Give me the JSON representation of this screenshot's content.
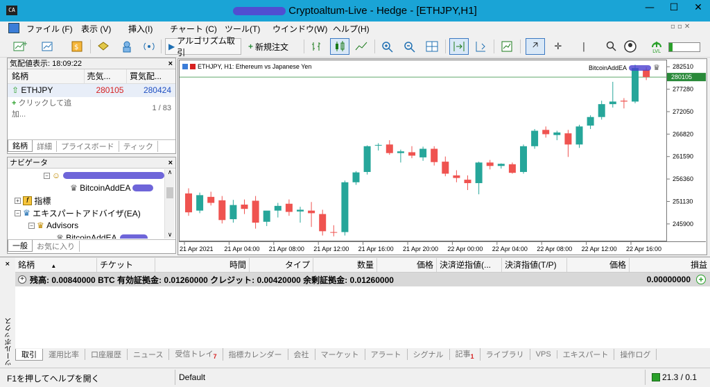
{
  "window": {
    "app_icon": "CA",
    "title": "Cryptoaltum-Live - Hedge - [ETHJPY,H1]",
    "controls": [
      "—",
      "☐",
      "✕"
    ]
  },
  "menu": [
    "ファイル (F)",
    "表示 (V)",
    "挿入(I)",
    "チャート (C)",
    "ツール(T)",
    "ウインドウ(W)",
    "ヘルプ(H)"
  ],
  "toolbar": {
    "algo_label": "アルゴリズム取引",
    "new_order_label": "新規注文",
    "notification_count": "1",
    "lvl_label": "LVL"
  },
  "market_watch": {
    "header": "気配値表示: 18:09:22",
    "columns": [
      "銘柄",
      "売気...",
      "買気配..."
    ],
    "rows": [
      {
        "symbol": "ETHJPY",
        "bid": "280105",
        "ask": "280424"
      }
    ],
    "add_label": "クリックして追加...",
    "count": "1 / 83",
    "tabs": [
      "銘柄",
      "詳細",
      "プライスボード",
      "ティック"
    ]
  },
  "navigator": {
    "header": "ナビゲータ",
    "items": [
      "BitcoinAddEA",
      "指標",
      "エキスパートアドバイザ(EA)",
      "Advisors",
      "BitcoinAddEA"
    ],
    "tabs": [
      "一般",
      "お気に入り"
    ]
  },
  "chart": {
    "header": "ETHJPY, H1:  Ethereum vs Japanese Yen",
    "ea_label": "BitcoinAddEA",
    "current_price": "280105",
    "price_ticks": [
      "282510",
      "277280",
      "272050",
      "266820",
      "261590",
      "256360",
      "251130",
      "245900"
    ],
    "time_ticks": [
      "21 Apr 2021",
      "21 Apr 04:00",
      "21 Apr 08:00",
      "21 Apr 12:00",
      "21 Apr 16:00",
      "21 Apr 20:00",
      "22 Apr 00:00",
      "22 Apr 04:00",
      "22 Apr 08:00",
      "22 Apr 12:00",
      "22 Apr 16:00"
    ]
  },
  "chart_data": {
    "type": "candlestick",
    "symbol": "ETHJPY",
    "timeframe": "H1",
    "ylim": [
      242000,
      284000
    ],
    "candles": [
      {
        "o": 253000,
        "h": 254200,
        "l": 247800,
        "c": 248600
      },
      {
        "o": 249000,
        "h": 253200,
        "l": 248400,
        "c": 252600
      },
      {
        "o": 252200,
        "h": 253400,
        "l": 250200,
        "c": 250800
      },
      {
        "o": 251400,
        "h": 252400,
        "l": 246000,
        "c": 246800
      },
      {
        "o": 247000,
        "h": 251500,
        "l": 246200,
        "c": 250300
      },
      {
        "o": 250400,
        "h": 251600,
        "l": 248200,
        "c": 249400
      },
      {
        "o": 251300,
        "h": 252400,
        "l": 244800,
        "c": 246200
      },
      {
        "o": 246400,
        "h": 248600,
        "l": 245400,
        "c": 249000
      },
      {
        "o": 249000,
        "h": 250800,
        "l": 247400,
        "c": 250100
      },
      {
        "o": 250600,
        "h": 251600,
        "l": 247800,
        "c": 248700
      },
      {
        "o": 248800,
        "h": 249900,
        "l": 246200,
        "c": 249200
      },
      {
        "o": 249000,
        "h": 251000,
        "l": 245200,
        "c": 248400
      },
      {
        "o": 248200,
        "h": 249200,
        "l": 243200,
        "c": 244200
      },
      {
        "o": 244000,
        "h": 245600,
        "l": 243000,
        "c": 243900
      },
      {
        "o": 244000,
        "h": 256000,
        "l": 243200,
        "c": 255600
      },
      {
        "o": 255600,
        "h": 258200,
        "l": 255000,
        "c": 257900
      },
      {
        "o": 258000,
        "h": 264200,
        "l": 257400,
        "c": 264000
      },
      {
        "o": 264200,
        "h": 264700,
        "l": 263000,
        "c": 264300
      },
      {
        "o": 264400,
        "h": 265400,
        "l": 262000,
        "c": 262400
      },
      {
        "o": 262400,
        "h": 263200,
        "l": 260200,
        "c": 262800
      },
      {
        "o": 262600,
        "h": 264000,
        "l": 261200,
        "c": 261800
      },
      {
        "o": 261400,
        "h": 263900,
        "l": 260600,
        "c": 263400
      },
      {
        "o": 263400,
        "h": 264000,
        "l": 259500,
        "c": 260300
      },
      {
        "o": 260400,
        "h": 261600,
        "l": 257000,
        "c": 257600
      },
      {
        "o": 257200,
        "h": 258400,
        "l": 255600,
        "c": 256600
      },
      {
        "o": 256200,
        "h": 257200,
        "l": 253800,
        "c": 255400
      },
      {
        "o": 255400,
        "h": 260400,
        "l": 252800,
        "c": 260200
      },
      {
        "o": 260200,
        "h": 260800,
        "l": 258600,
        "c": 259400
      },
      {
        "o": 259400,
        "h": 260000,
        "l": 258800,
        "c": 259900
      },
      {
        "o": 259800,
        "h": 260200,
        "l": 257600,
        "c": 257800
      },
      {
        "o": 258000,
        "h": 264400,
        "l": 257600,
        "c": 264000
      },
      {
        "o": 264000,
        "h": 268000,
        "l": 263400,
        "c": 267600
      },
      {
        "o": 267800,
        "h": 268600,
        "l": 266000,
        "c": 266800
      },
      {
        "o": 266600,
        "h": 267600,
        "l": 265400,
        "c": 267200
      },
      {
        "o": 267000,
        "h": 267800,
        "l": 261500,
        "c": 264400
      },
      {
        "o": 264400,
        "h": 269000,
        "l": 263600,
        "c": 268600
      },
      {
        "o": 268800,
        "h": 271200,
        "l": 268000,
        "c": 270800
      },
      {
        "o": 270800,
        "h": 274600,
        "l": 270200,
        "c": 273800
      },
      {
        "o": 273800,
        "h": 279000,
        "l": 273000,
        "c": 274400
      },
      {
        "o": 274600,
        "h": 275200,
        "l": 272800,
        "c": 274400
      },
      {
        "o": 274400,
        "h": 283000,
        "l": 274000,
        "c": 282200
      },
      {
        "o": 281800,
        "h": 282400,
        "l": 279400,
        "c": 280105
      }
    ]
  },
  "terminal": {
    "side_label": "ツールボックス",
    "columns": [
      "銘柄",
      "チケット",
      "時間",
      "タイプ",
      "数量",
      "価格",
      "決済逆指値(...",
      "決済指値(T/P)",
      "価格",
      "損益"
    ],
    "balance_row": "残高: 0.00840000 BTC  有効証拠金: 0.01260000  クレジット: 0.00420000  余剰証拠金: 0.01260000",
    "profit": "0.00000000",
    "tabs": [
      "取引",
      "運用比率",
      "口座履歴",
      "ニュース",
      "受信トレイ",
      "指標カレンダー",
      "会社",
      "マーケット",
      "アラート",
      "シグナル",
      "記事",
      "ライブラリ",
      "VPS",
      "エキスパート",
      "操作ログ"
    ],
    "tab_badges": {
      "受信トレイ": "7",
      "記事": "1"
    }
  },
  "status": {
    "help": "F1を押してヘルプを開く",
    "profile": "Default",
    "connection": "21.3 / 0.1"
  }
}
